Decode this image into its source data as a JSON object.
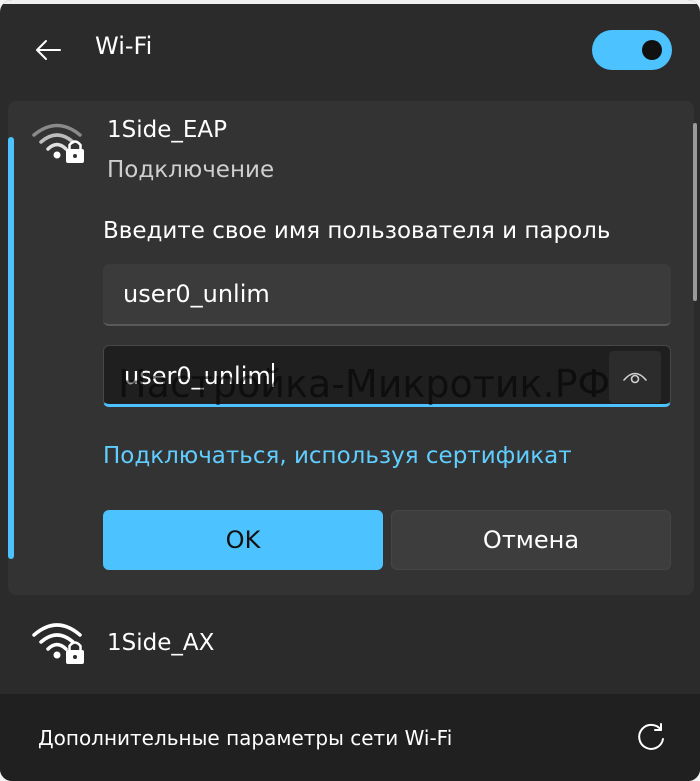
{
  "header": {
    "title": "Wi-Fi",
    "back_icon": "back-arrow-icon",
    "wifi_toggle_on": true
  },
  "expanded_network": {
    "ssid": "1Side_EAP",
    "status": "Подключение",
    "icon": "wifi-secured-icon",
    "prompt": "Введите свое имя пользователя и пароль",
    "username_value": "user0_unlim",
    "password_value": "user0_unlim",
    "reveal_icon": "eye-icon",
    "watermark": "Настройка-Микротик.РФ",
    "certificate_link": "Подключаться, используя сертификат",
    "ok_label": "OK",
    "cancel_label": "Отмена"
  },
  "other_networks": [
    {
      "ssid": "1Side_AX",
      "icon": "wifi-secured-icon"
    }
  ],
  "footer": {
    "link": "Дополнительные параметры сети Wi-Fi",
    "refresh_icon": "refresh-icon"
  },
  "colors": {
    "accent": "#4cc2ff",
    "link": "#60cdff",
    "panel": "#2b2b2b",
    "expanded_bg": "#333333",
    "footer_bg": "#202020"
  }
}
